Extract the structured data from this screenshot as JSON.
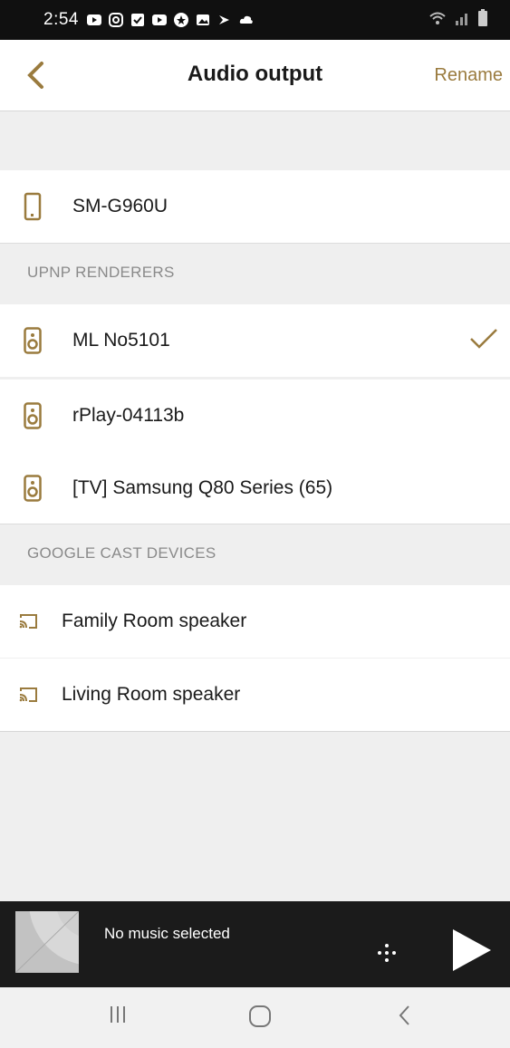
{
  "status_bar": {
    "time": "2:54"
  },
  "header": {
    "title": "Audio output",
    "rename_label": "Rename"
  },
  "colors": {
    "accent": "#9a7b3e",
    "section_bg": "#efefef",
    "player_bg": "#1b1b1b"
  },
  "local_device": {
    "name": "SM-G960U",
    "icon": "phone-icon"
  },
  "sections": {
    "upnp": {
      "title": "UPNP RENDERERS",
      "items": [
        {
          "name": "ML No5101",
          "icon": "speaker-icon",
          "selected": true
        },
        {
          "name": "rPlay-04113b",
          "icon": "speaker-icon",
          "selected": false
        },
        {
          "name": "[TV] Samsung Q80 Series (65)",
          "icon": "speaker-icon",
          "selected": false
        }
      ]
    },
    "cast": {
      "title": "GOOGLE CAST DEVICES",
      "items": [
        {
          "name": "Family Room speaker",
          "icon": "cast-icon"
        },
        {
          "name": "Living Room speaker",
          "icon": "cast-icon"
        }
      ]
    }
  },
  "player": {
    "status": "No music selected"
  },
  "nav": {
    "recent": "recent-apps-icon",
    "home": "home-icon",
    "back": "back-icon"
  }
}
